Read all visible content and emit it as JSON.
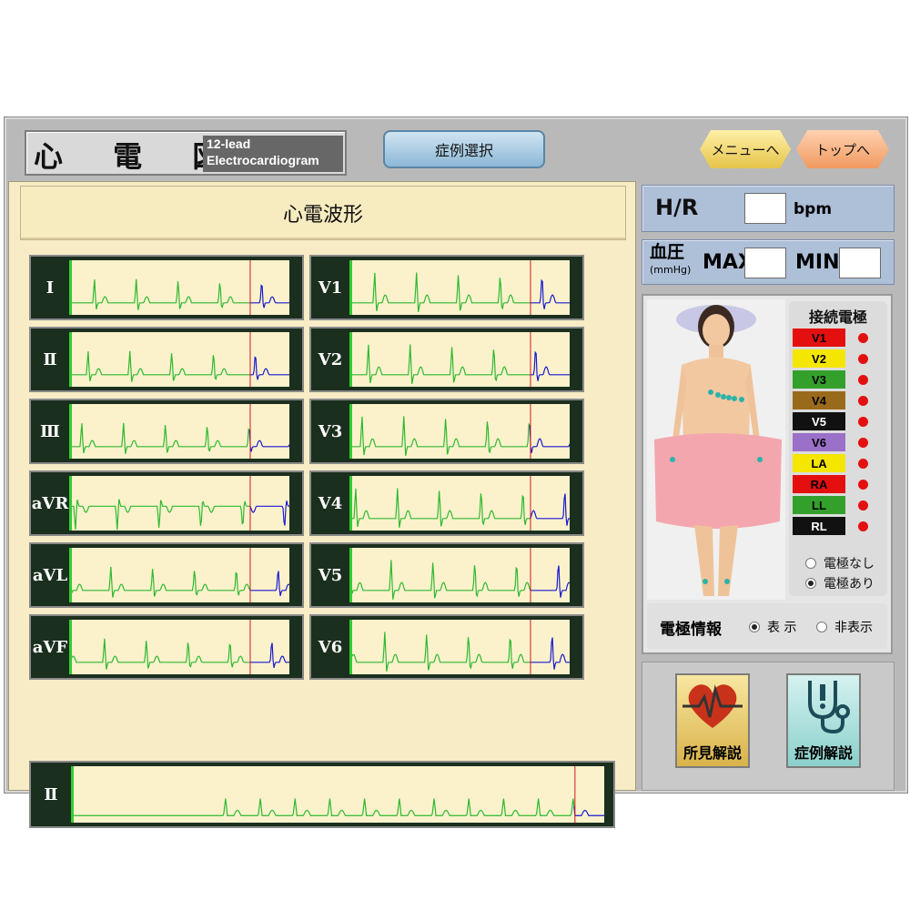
{
  "header": {
    "logo_kanji": "心 電 図",
    "logo_sub_line1": "12-lead",
    "logo_sub_line2": "Electrocardiogram",
    "case_select": "症例選択",
    "menu": "メニューへ",
    "top": "トップへ"
  },
  "waveform_panel": {
    "title": "心電波形",
    "leads_left": [
      "I",
      "Ⅱ",
      "Ⅲ",
      "aVR",
      "aVL",
      "aVF"
    ],
    "leads_right": [
      "V1",
      "V2",
      "V3",
      "V4",
      "V5",
      "V6"
    ],
    "long_lead": "Ⅱ"
  },
  "vitals": {
    "hr_label": "H/R",
    "hr_value": "",
    "hr_unit": "bpm",
    "bp_label": "血圧",
    "bp_unit": "(mmHg)",
    "max_label": "MAX",
    "max_value": "",
    "min_label": "MIN",
    "min_value": ""
  },
  "electrodes": {
    "title": "接続電極",
    "items": [
      {
        "name": "V1",
        "color": "#e41010",
        "text_color": "#000000"
      },
      {
        "name": "V2",
        "color": "#f5e600",
        "text_color": "#000000"
      },
      {
        "name": "V3",
        "color": "#34a02c",
        "text_color": "#000000"
      },
      {
        "name": "V4",
        "color": "#9a6a1c",
        "text_color": "#000000"
      },
      {
        "name": "V5",
        "color": "#111111",
        "text_color": "#ffffff"
      },
      {
        "name": "V6",
        "color": "#9a70c8",
        "text_color": "#000000"
      },
      {
        "name": "LA",
        "color": "#f5e600",
        "text_color": "#000000"
      },
      {
        "name": "RA",
        "color": "#e41010",
        "text_color": "#000000"
      },
      {
        "name": "LL",
        "color": "#34a02c",
        "text_color": "#000000"
      },
      {
        "name": "RL",
        "color": "#111111",
        "text_color": "#ffffff"
      }
    ],
    "option_none": "電極なし",
    "option_present": "電極あり",
    "selected": "電極あり"
  },
  "electrode_info": {
    "label": "電極情報",
    "show": "表 示",
    "hide": "非表示",
    "selected": "表 示"
  },
  "buttons": {
    "findings": "所見解説",
    "case_explain": "症例解説"
  }
}
